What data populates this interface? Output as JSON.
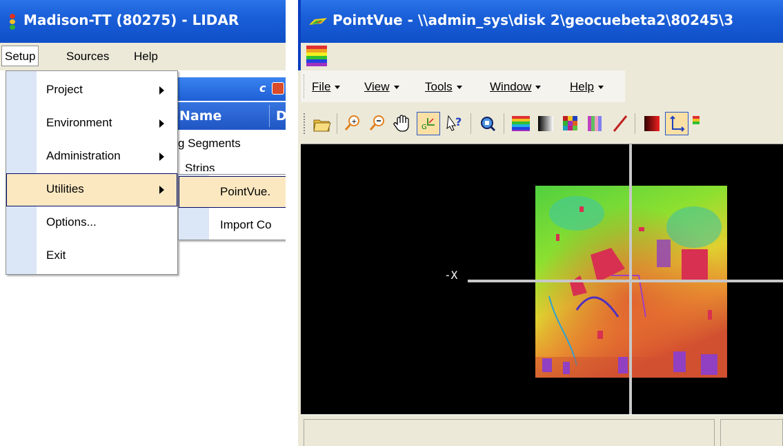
{
  "left_window": {
    "title": "Madison-TT (80275)  -  LIDAR",
    "menubar": [
      "Setup",
      "Sources",
      "Help"
    ],
    "background_panel": {
      "column_name": "Name",
      "column_d": "D",
      "rows": [
        "g Segments",
        "Strips"
      ]
    },
    "setup_menu": [
      {
        "label": "Project",
        "submenu": true,
        "highlighted": false
      },
      {
        "label": "Environment",
        "submenu": true,
        "highlighted": false
      },
      {
        "label": "Administration",
        "submenu": true,
        "highlighted": false
      },
      {
        "label": "Utilities",
        "submenu": true,
        "highlighted": true
      },
      {
        "label": "Options...",
        "submenu": false,
        "highlighted": false
      },
      {
        "label": "Exit",
        "submenu": false,
        "highlighted": false
      }
    ],
    "utilities_submenu": [
      {
        "label": "PointVue.",
        "highlighted": true
      },
      {
        "label": "Import Co",
        "highlighted": false
      }
    ]
  },
  "right_window": {
    "title": "PointVue - \\\\admin_sys\\disk 2\\geocuebeta2\\80245\\3",
    "menubar": [
      {
        "label": "File",
        "hotkey_index": 0
      },
      {
        "label": "View",
        "hotkey_index": 0
      },
      {
        "label": "Tools",
        "hotkey_index": 0
      },
      {
        "label": "Window",
        "hotkey_index": 0
      },
      {
        "label": "Help",
        "hotkey_index": 0
      }
    ],
    "toolbar_icons": [
      "open-folder-icon",
      "zoom-in-icon",
      "zoom-out-icon",
      "pan-hand-icon",
      "georeference-icon",
      "query-icon",
      "zoom-extents-icon",
      "color-elevation-icon",
      "color-intensity-icon",
      "color-class-icon",
      "color-rgb-icon",
      "profile-line-icon",
      "color-red-ramp-icon",
      "axes-icon"
    ],
    "axis_label": "-X"
  },
  "colors": {
    "titlebar": "#1a5fd8",
    "menu_highlight": "#fbe8c1",
    "menu_gutter": "#dbe6f6",
    "chrome": "#ece9d8",
    "viewport": "#000000",
    "crosshair": "#c8c8c8"
  }
}
